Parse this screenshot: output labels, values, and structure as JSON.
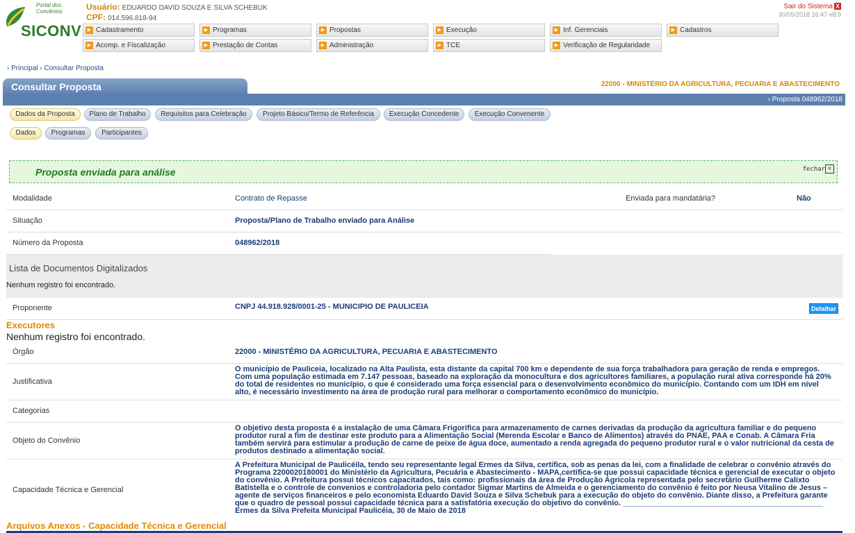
{
  "logo": {
    "small_text": "Portal dos Convênios",
    "big_text": "SICONV"
  },
  "header": {
    "user_label": "Usuário:",
    "user_name": "EDUARDO DAVID SOUZA E SILVA SCHEBUK",
    "cpf_label": "CPF:",
    "cpf_value": "014.596.818-94",
    "logout_label": "Sair do Sistema",
    "logout_icon": "X",
    "datetime": "30/05/2018 16:47-v8.9"
  },
  "menu": [
    "Cadastramento",
    "Programas",
    "Propostas",
    "Execução",
    "Inf. Gerenciais",
    "Cadastros",
    "Acomp. e Fiscalização",
    "Prestação de Contas",
    "Administração",
    "TCE",
    "Verificação de Regularidade"
  ],
  "menu_icon": "orange-arrow-icon",
  "breadcrumb": [
    "Principal",
    "Consultar Proposta"
  ],
  "page": {
    "title": "Consultar Proposta",
    "ministry": "22000 - MINISTÉRIO DA AGRICULTURA, PECUARIA E ABASTECIMENTO",
    "proposal_ref": "Proposta 048962/2018"
  },
  "tabs_main": [
    "Dados da Proposta",
    "Plano de Trabalho",
    "Requisitos para Celebração",
    "Projeto Básico/Termo de Referência",
    "Execução Concedente",
    "Execução Convenente"
  ],
  "tabs_sub": [
    "Dados",
    "Programas",
    "Participantes"
  ],
  "message": {
    "text": "Proposta enviada para análise",
    "close_label": "fechar"
  },
  "fields": {
    "modalidade_label": "Modalidade",
    "modalidade_value": "Contrato de Repasse",
    "mandataria_label": "Enviada para mandatária?",
    "mandataria_value": "Não",
    "situacao_label": "Situação",
    "situacao_value": "Proposta/Plano de Trabalho enviado para Análise",
    "numero_label": "Número da Proposta",
    "numero_value": "048962/2018"
  },
  "documentos": {
    "heading": "Lista de Documentos Digitalizados",
    "empty": "Nenhum registro foi encontrado."
  },
  "proponente": {
    "label": "Proponente",
    "value": "CNPJ 44.918.928/0001-25 - MUNICIPIO DE PAULICEIA",
    "button": "Detalhar"
  },
  "executores": {
    "heading": "Executores",
    "empty": "Nenhum registro foi encontrado."
  },
  "orgao": {
    "label": "Órgão",
    "value": "22000 - MINISTÉRIO DA AGRICULTURA, PECUARIA E ABASTECIMENTO"
  },
  "justificativa": {
    "label": "Justificativa",
    "value": "O município de Pauliceia, localizado na Alta Paulista, esta distante da capital 700 km e dependente de sua força trabalhadora para geração de renda e empregos. Com uma população estimada em 7.147 pessoas, baseado na exploração da monocultura e dos agricultores familiares, a população rural ativa corresponde há 20% do total de residentes no município, o que é considerado uma força essencial para o desenvolvimento econômico do município. Contando com um IDH em nível alto, é necessário investimento na área de produção rural para melhorar o comportamento econômico do município."
  },
  "categorias": {
    "label": "Categorias",
    "value": ""
  },
  "objeto": {
    "label": "Objeto do Convênio",
    "value": "O objetivo desta proposta é a instalação de uma Câmara Frigorifica para armazenamento de carnes derivadas da produção da agricultura familiar e do pequeno produtor rural a fim de destinar este produto para a Alimentação Social (Merenda Escolar e Banco de Alimentos) através do PNAE, PAA e Conab. A Câmara Fria também servirá para estimular a produção de carne de peixe de água doce, aumentado a renda agregada do pequeno produtor rural e o valor nutricional da cesta de produtos destinado a alimentação social."
  },
  "capacidade": {
    "label": "Capacidade Técnica e Gerencial",
    "value": "A Prefeitura Municipal de Paulicéila, tendo seu representante legal Ermes da Silva, certifica, sob as penas da lei, com a finalidade de celebrar o convênio através do Programa 2200020180001 do Ministério da Agricultura, Pecuária e Abastecimento - MAPA,certifica-se que possui capacidade técnica e gerencial de executar o objeto do convênio. A Prefeitura possui técnicos capacitados, tais como: profissionais da área de Produção Agricola representada pelo secretário Guilherme Calixto Batistella e o controle de convenios e controladoria pelo contador Sigmar Martins de Almeida e o gerenciamento do convênio é feito por Neusa Vitalino de Jesus – agente de serviços financeiros e pelo economista Eduardo David Souza e Silva Schebuk para a execução do objeto do convênio. Diante disso, a Prefeitura garante que o quadro de pessoal possui capacidade técnica para a satisfatória execução do objetivo do convênio. _______________________________________________ Ermes da Silva Prefeita Municipal Paulicéia, 30 de Maio de 2018"
  },
  "anexos": {
    "heading": "Arquivos Anexos - Capacidade Técnica e Gerencial"
  }
}
